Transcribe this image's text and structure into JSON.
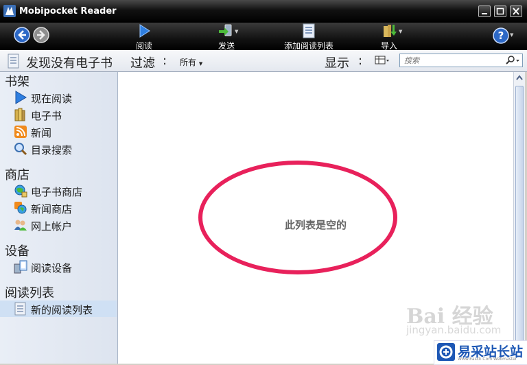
{
  "window": {
    "title": "Mobipocket Reader"
  },
  "toolbar": {
    "read": "阅读",
    "send": "发送",
    "add_reading_list": "添加阅读列表",
    "import": "导入"
  },
  "filterbar": {
    "status": "发现没有电子书",
    "filter_label": "过滤",
    "colon": ":",
    "filter_value": "所有",
    "display_label": "显示",
    "search_placeholder": "搜索"
  },
  "sidebar": {
    "sections": [
      {
        "heading": "书架",
        "items": [
          "现在阅读",
          "电子书",
          "新闻",
          "目录搜索"
        ]
      },
      {
        "heading": "商店",
        "items": [
          "电子书商店",
          "新闻商店",
          "网上帐户"
        ]
      },
      {
        "heading": "设备",
        "items": [
          "阅读设备"
        ]
      },
      {
        "heading": "阅读列表",
        "items": [
          "新的阅读列表"
        ]
      }
    ]
  },
  "main": {
    "empty_message": "此列表是空的"
  },
  "watermarks": {
    "baidu": "Bai 经验",
    "baidu_url": "jingyan.baidu.com",
    "site_name": "易采站长站",
    "site_sub": "Www.Easck.Com Webmaster"
  },
  "colors": {
    "highlight_ring": "#e8215b",
    "site_blue": "#1d57b5"
  }
}
